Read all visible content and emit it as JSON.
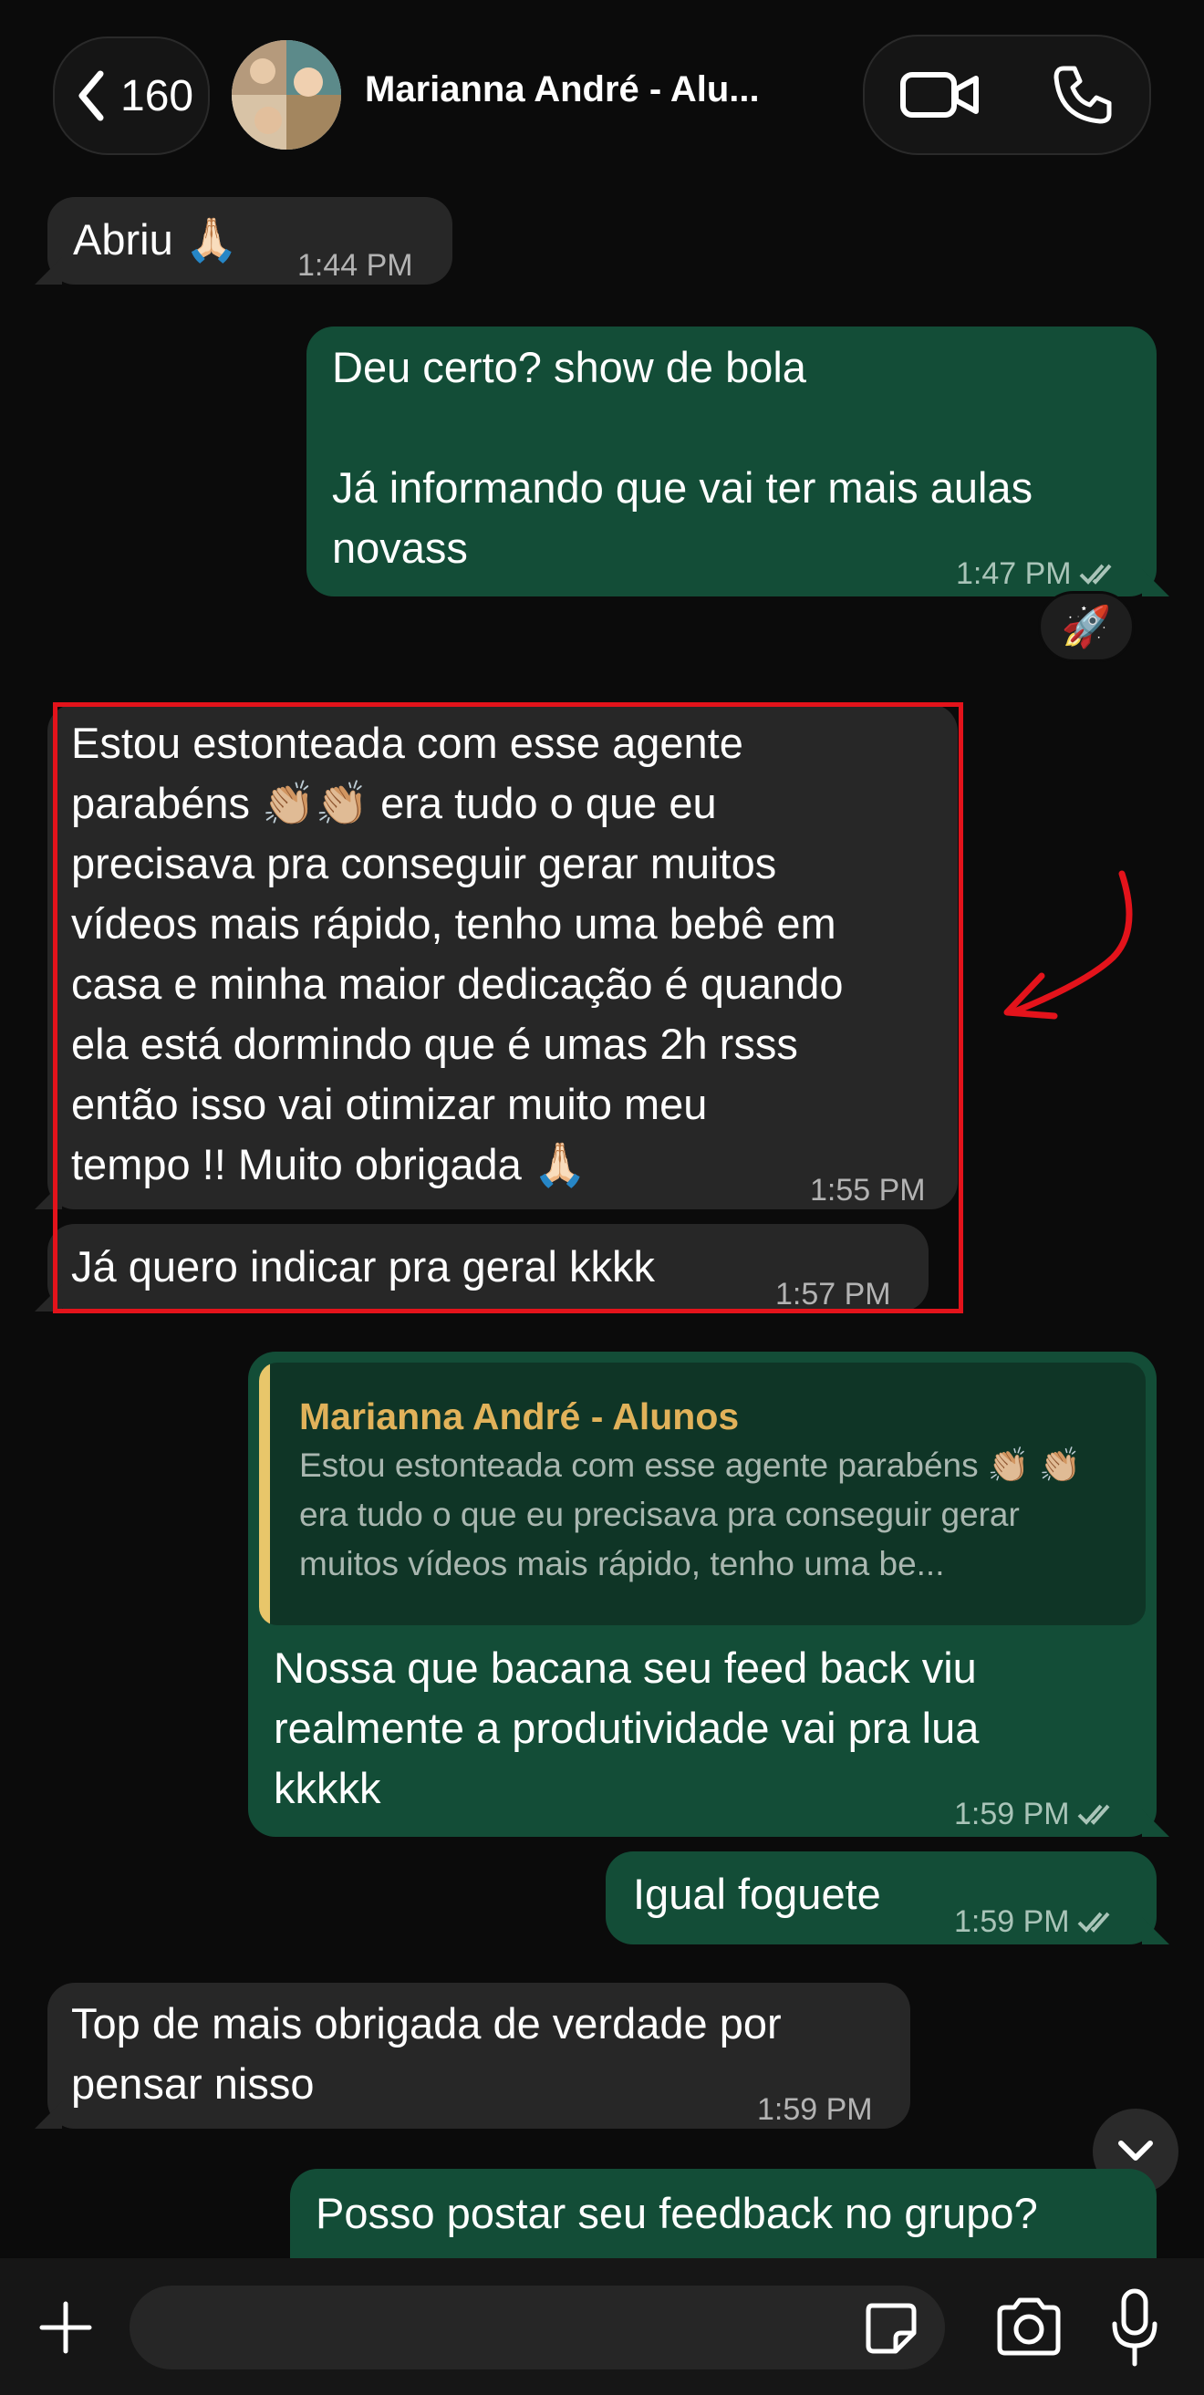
{
  "header": {
    "back_count": "160",
    "title": "Marianna André - Alu..."
  },
  "messages": [
    {
      "text": "Abriu 🙏🏻",
      "time": "1:44 PM"
    },
    {
      "text": "Deu certo? show de bola\n\nJá informando que vai ter mais aulas\nnovass",
      "time": "1:47 PM",
      "reaction": "🚀"
    },
    {
      "text": "Estou estonteada com esse agente\nparabéns 👏🏼👏🏼 era tudo o que eu\nprecisava pra conseguir gerar muitos\nvídeos mais rápido, tenho uma bebê em\ncasa e minha maior dedicação é quando\nela está dormindo que é umas 2h rsss\nentão isso vai otimizar muito meu\ntempo !! Muito obrigada 🙏🏻",
      "time": "1:55 PM"
    },
    {
      "text": "Já quero indicar pra geral kkkk",
      "time": "1:57 PM"
    },
    {
      "quote_author": "Marianna André - Alunos",
      "quote_text": "Estou estonteada com esse agente parabéns 👏🏼 👏🏼 era tudo o que eu precisava pra conseguir gerar muitos vídeos mais rápido, tenho uma be...",
      "text": "Nossa que bacana seu feed back viu\nrealmente a produtividade vai pra lua\nkkkkk",
      "time": "1:59 PM"
    },
    {
      "text": "Igual foguete",
      "time": "1:59 PM"
    },
    {
      "text": "Top de mais obrigada de verdade por\npensar nisso",
      "time": "1:59 PM"
    },
    {
      "text": "Posso postar seu feedback no grupo?"
    }
  ],
  "colors": {
    "incoming_bubble": "#272727",
    "outgoing_bubble": "#134d37",
    "highlight": "#e3131b",
    "quote_author": "#e1b25a"
  }
}
